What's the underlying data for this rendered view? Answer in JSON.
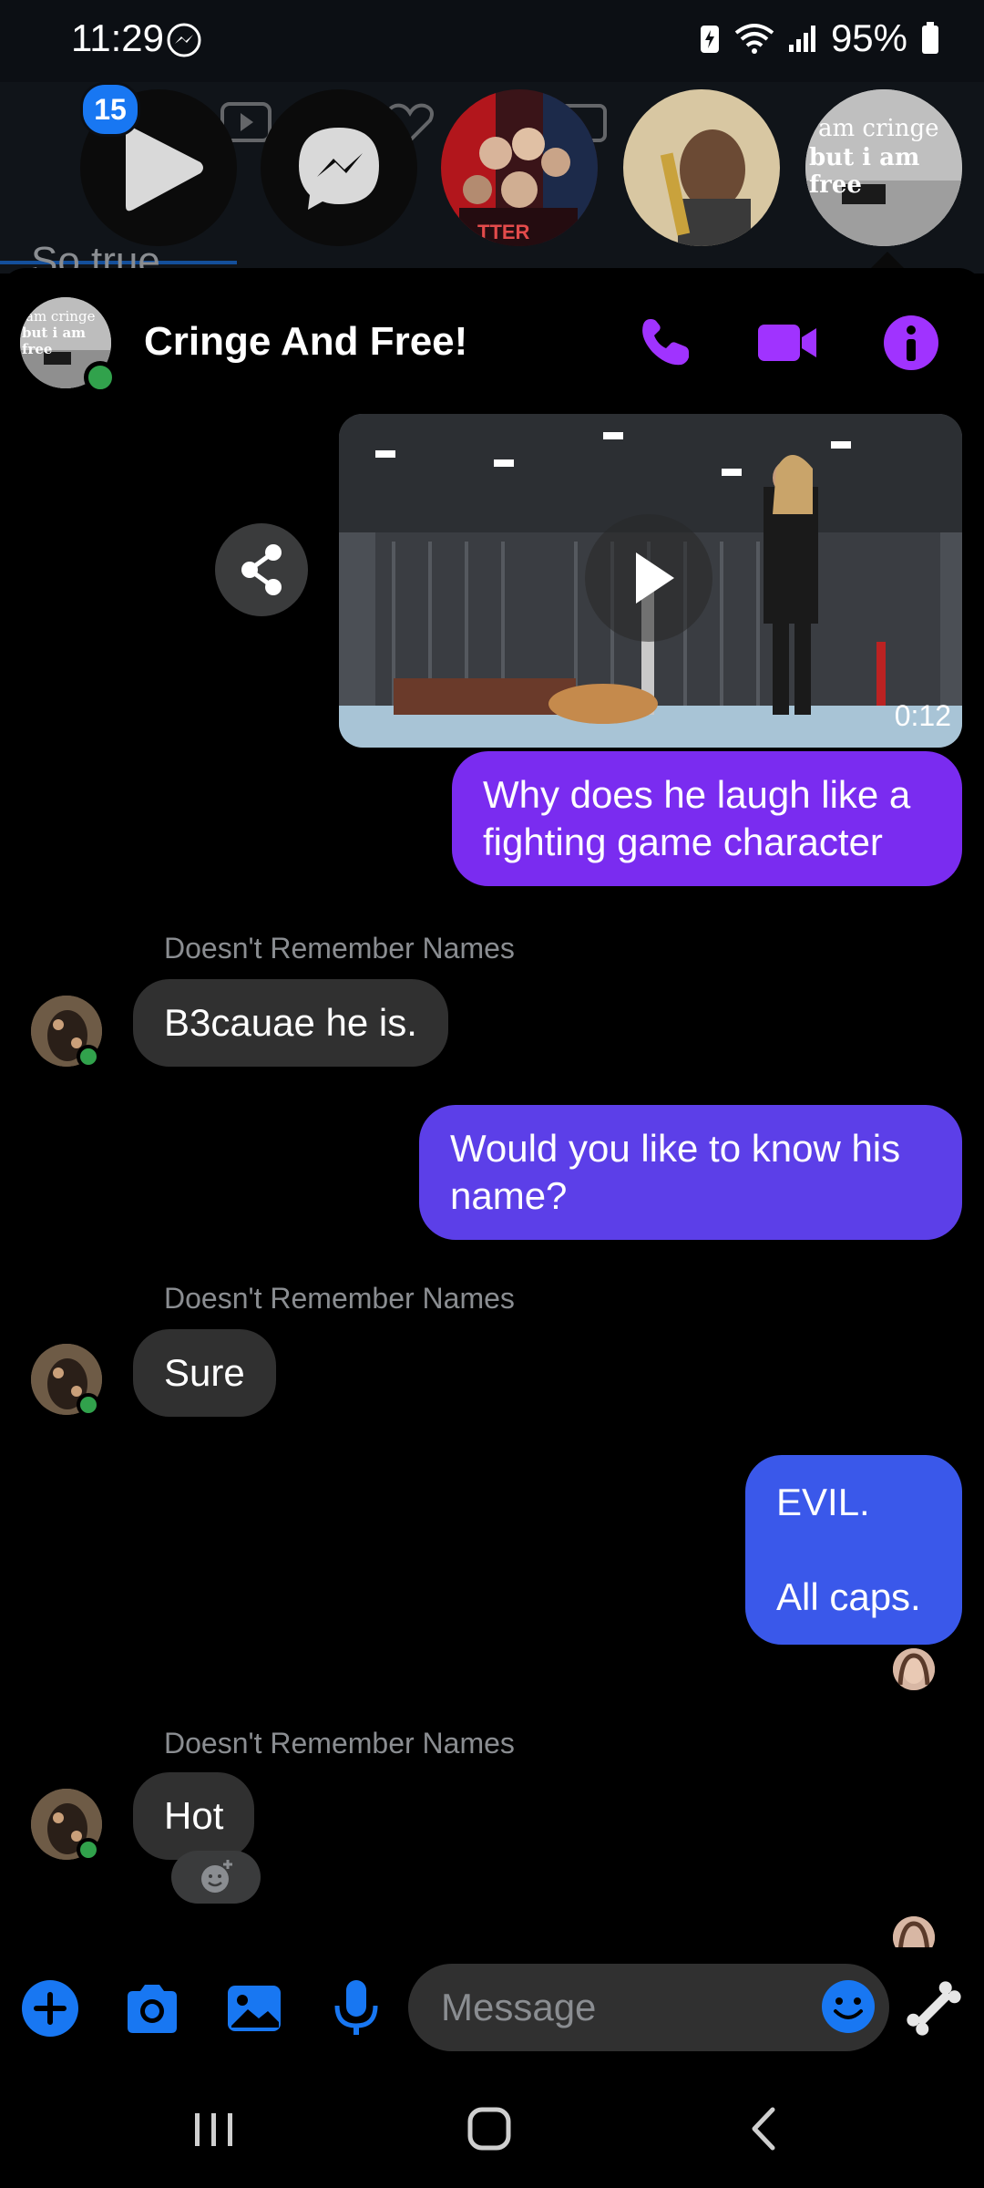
{
  "status_bar": {
    "time": "11:29",
    "battery": "95%",
    "icons": [
      "messenger-icon",
      "battery-saver-icon",
      "wifi-icon",
      "signal-icon",
      "battery-icon"
    ]
  },
  "chat_heads": {
    "unread_badge": "15",
    "background_preview": "So true",
    "group_thumbnail_text_line1": "am cringe",
    "group_thumbnail_text_line2": "but i am free",
    "wrestlers_thumbnail_text": "TTER"
  },
  "conversation": {
    "title": "Cringe And Free!",
    "avatar_text_line1": "am cringe",
    "avatar_text_line2": "but i am free",
    "accent_color": "#a033ff"
  },
  "messages": [
    {
      "id": "video",
      "from": "me",
      "type": "video",
      "duration": "0:12"
    },
    {
      "id": "m1",
      "from": "me",
      "text": "Why does he laugh like a fighting game character"
    },
    {
      "id": "m2",
      "from": "them",
      "sender": "Doesn't Remember Names",
      "text": "B3cauae he is."
    },
    {
      "id": "m3",
      "from": "me",
      "text": "Would you like to know his name?"
    },
    {
      "id": "m4",
      "from": "them",
      "sender": "Doesn't Remember Names",
      "text": "Sure"
    },
    {
      "id": "m5",
      "from": "me",
      "line1": "EVIL.",
      "line2": "All caps."
    },
    {
      "id": "m6",
      "from": "them",
      "sender": "Doesn't Remember Names",
      "text": "Hot"
    }
  ],
  "composer": {
    "placeholder": "Message",
    "buttons": [
      "plus-icon",
      "camera-icon",
      "gallery-icon",
      "microphone-icon",
      "emoji-icon",
      "bone-icon"
    ],
    "color": "#1877f2"
  },
  "nav": {
    "buttons": [
      "recents-icon",
      "home-icon",
      "back-icon"
    ]
  }
}
